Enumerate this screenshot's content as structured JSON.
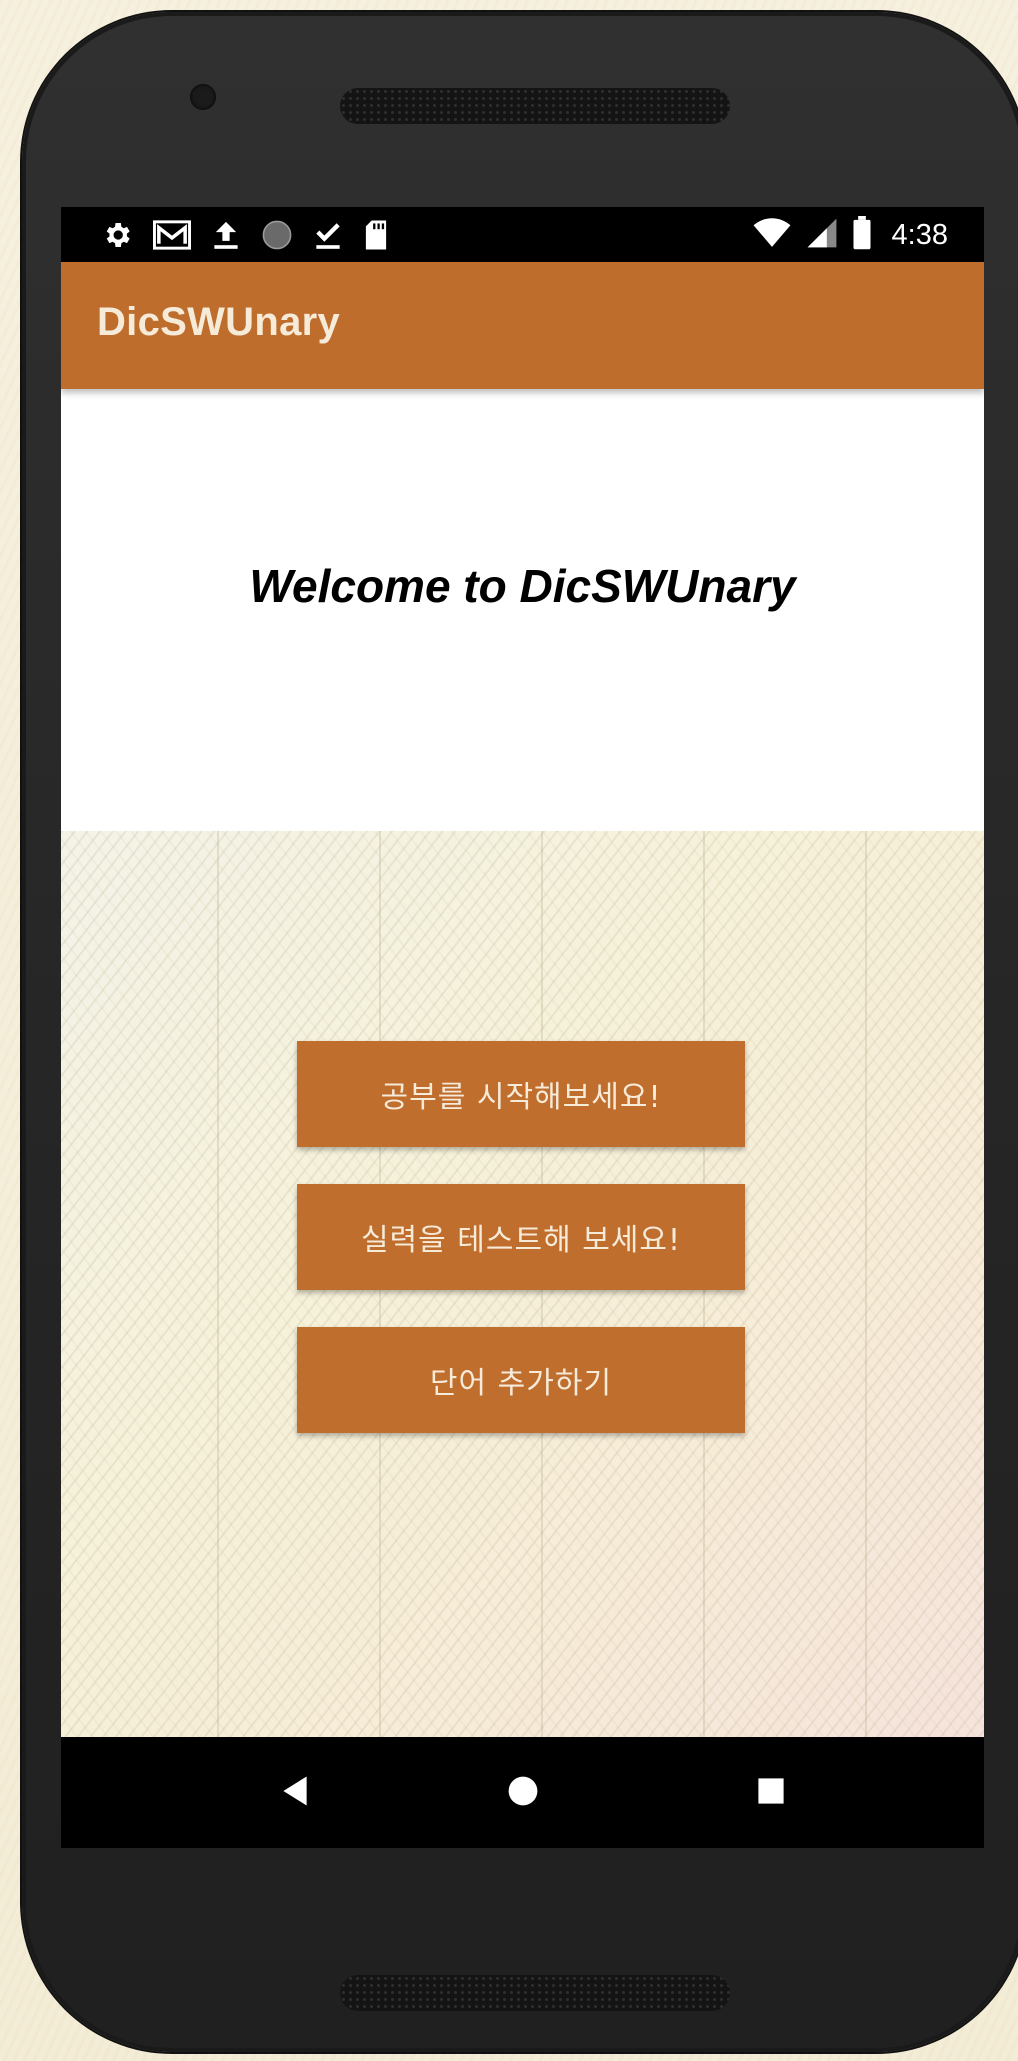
{
  "status_bar": {
    "time": "4:38",
    "left_icons": [
      "gear-icon",
      "gmail-icon",
      "upload-icon",
      "circle-icon",
      "download-done-icon",
      "sd-card-icon"
    ],
    "right_icons": [
      "wifi-icon",
      "cell-signal-icon",
      "battery-icon"
    ]
  },
  "app_bar": {
    "title": "DicSWUnary"
  },
  "welcome": {
    "text": "Welcome to DicSWUnary"
  },
  "menu": {
    "study_label": "공부를 시작해보세요!",
    "test_label": "실력을 테스트해 보세요!",
    "add_word_label": "단어 추가하기"
  },
  "nav_bar": {
    "icons": [
      "back-icon",
      "home-icon",
      "recents-icon"
    ]
  },
  "colors": {
    "primary": "#bf6d2c",
    "button": "#c06e2d",
    "button_text": "#f6ead9",
    "status_bar": "#000000"
  }
}
